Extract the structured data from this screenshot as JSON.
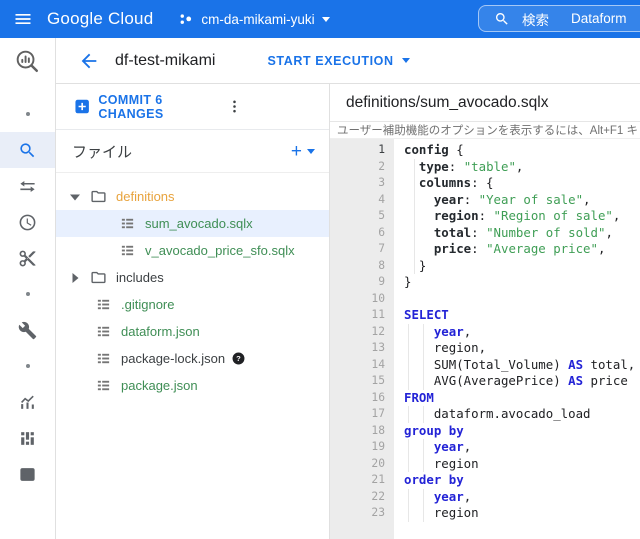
{
  "topbar": {
    "brand": "Google Cloud",
    "project": "cm-da-mikami-yuki",
    "search": {
      "label": "検索",
      "value": "Dataform"
    }
  },
  "toolbar": {
    "title": "df-test-mikami",
    "start_execution_label": "START EXECUTION"
  },
  "left_rail": {
    "items": [
      {
        "icon": "dot",
        "active": false
      },
      {
        "icon": "search",
        "active": true
      },
      {
        "icon": "sync-alt",
        "active": false
      },
      {
        "icon": "clock",
        "active": false
      },
      {
        "icon": "cut",
        "active": false
      },
      {
        "icon": "dot",
        "active": false
      },
      {
        "icon": "wrench",
        "active": false
      },
      {
        "icon": "dot",
        "active": false
      },
      {
        "icon": "analytics",
        "active": false
      },
      {
        "icon": "bi-blocks",
        "active": false
      },
      {
        "icon": "table-grid",
        "active": false
      }
    ]
  },
  "files_panel": {
    "commit_label": "COMMIT 6 CHANGES",
    "header_title": "ファイル",
    "add_label": "+",
    "tree": [
      {
        "label": "definitions",
        "kind": "folder",
        "expanded": true,
        "color": "modified"
      },
      {
        "label": "sum_avocado.sqlx",
        "kind": "file",
        "level": 1,
        "color": "added",
        "selected": true
      },
      {
        "label": "v_avocado_price_sfo.sqlx",
        "kind": "file",
        "level": 1,
        "color": "added"
      },
      {
        "label": "includes",
        "kind": "folder",
        "expanded": false,
        "color": "default"
      },
      {
        "label": ".gitignore",
        "kind": "file",
        "level": 0,
        "color": "added"
      },
      {
        "label": "dataform.json",
        "kind": "file",
        "level": 0,
        "color": "added"
      },
      {
        "label": "package-lock.json",
        "kind": "file",
        "level": 0,
        "color": "default",
        "badge": "help"
      },
      {
        "label": "package.json",
        "kind": "file",
        "level": 0,
        "color": "added"
      }
    ]
  },
  "editor": {
    "title": "definitions/sum_avocado.sqlx",
    "accessibility_hint": "ユーザー補助機能のオプションを表示するには、Alt+F1 キ",
    "code_lines": [
      {
        "n": 1,
        "g": 0,
        "seg": [
          [
            "config",
            "p"
          ],
          [
            " {",
            ""
          ]
        ]
      },
      {
        "n": 2,
        "g": 1,
        "seg": [
          [
            "  ",
            ""
          ],
          [
            "type",
            "p"
          ],
          [
            ": ",
            ""
          ],
          [
            "\"table\"",
            "s"
          ],
          [
            ",",
            ""
          ]
        ]
      },
      {
        "n": 3,
        "g": 1,
        "seg": [
          [
            "  ",
            ""
          ],
          [
            "columns",
            "p"
          ],
          [
            ": {",
            ""
          ]
        ]
      },
      {
        "n": 4,
        "g": 1,
        "seg": [
          [
            "    ",
            ""
          ],
          [
            "year",
            "p"
          ],
          [
            ": ",
            ""
          ],
          [
            "\"Year of sale\"",
            "s"
          ],
          [
            ",",
            ""
          ]
        ]
      },
      {
        "n": 5,
        "g": 1,
        "seg": [
          [
            "    ",
            ""
          ],
          [
            "region",
            "p"
          ],
          [
            ": ",
            ""
          ],
          [
            "\"Region of sale\"",
            "s"
          ],
          [
            ",",
            ""
          ]
        ]
      },
      {
        "n": 6,
        "g": 1,
        "seg": [
          [
            "    ",
            ""
          ],
          [
            "total",
            "p"
          ],
          [
            ": ",
            ""
          ],
          [
            "\"Number of sold\"",
            "s"
          ],
          [
            ",",
            ""
          ]
        ]
      },
      {
        "n": 7,
        "g": 1,
        "seg": [
          [
            "    ",
            ""
          ],
          [
            "price",
            "p"
          ],
          [
            ": ",
            ""
          ],
          [
            "\"Average price\"",
            "s"
          ],
          [
            ",",
            ""
          ]
        ]
      },
      {
        "n": 8,
        "g": 1,
        "seg": [
          [
            "  }",
            ""
          ]
        ]
      },
      {
        "n": 9,
        "g": 0,
        "seg": [
          [
            "}",
            ""
          ]
        ]
      },
      {
        "n": 10,
        "g": 0,
        "seg": []
      },
      {
        "n": 11,
        "g": 0,
        "seg": [
          [
            "SELECT",
            "b"
          ]
        ]
      },
      {
        "n": 12,
        "g": 2,
        "seg": [
          [
            "    ",
            ""
          ],
          [
            "year",
            "b"
          ],
          [
            ",",
            ""
          ]
        ]
      },
      {
        "n": 13,
        "g": 2,
        "seg": [
          [
            "    region,",
            ""
          ]
        ]
      },
      {
        "n": 14,
        "g": 2,
        "seg": [
          [
            "    SUM(Total_Volume) ",
            ""
          ],
          [
            "AS",
            "b"
          ],
          [
            " total,",
            ""
          ]
        ]
      },
      {
        "n": 15,
        "g": 2,
        "seg": [
          [
            "    AVG(AveragePrice) ",
            ""
          ],
          [
            "AS",
            "b"
          ],
          [
            " price",
            ""
          ]
        ]
      },
      {
        "n": 16,
        "g": 0,
        "seg": [
          [
            "FROM",
            "b"
          ]
        ]
      },
      {
        "n": 17,
        "g": 2,
        "seg": [
          [
            "    dataform.avocado_load",
            ""
          ]
        ]
      },
      {
        "n": 18,
        "g": 0,
        "seg": [
          [
            "group by",
            "b"
          ]
        ]
      },
      {
        "n": 19,
        "g": 2,
        "seg": [
          [
            "    ",
            ""
          ],
          [
            "year",
            "b"
          ],
          [
            ",",
            ""
          ]
        ]
      },
      {
        "n": 20,
        "g": 2,
        "seg": [
          [
            "    region",
            ""
          ]
        ]
      },
      {
        "n": 21,
        "g": 0,
        "seg": [
          [
            "order by",
            "b"
          ]
        ]
      },
      {
        "n": 22,
        "g": 2,
        "seg": [
          [
            "    ",
            ""
          ],
          [
            "year",
            "b"
          ],
          [
            ",",
            ""
          ]
        ]
      },
      {
        "n": 23,
        "g": 2,
        "seg": [
          [
            "    region",
            ""
          ]
        ]
      }
    ]
  },
  "colors": {
    "topbar_bg": "#1a73e8",
    "accent_blue": "#1a73e8",
    "keyword_blue": "#2323d6",
    "string_green": "#3f9e55",
    "added_green": "#3f8e55",
    "modified_orange": "#e8a33d",
    "selection_bg": "#e8f0fe",
    "icon_gray": "#5f6368"
  }
}
